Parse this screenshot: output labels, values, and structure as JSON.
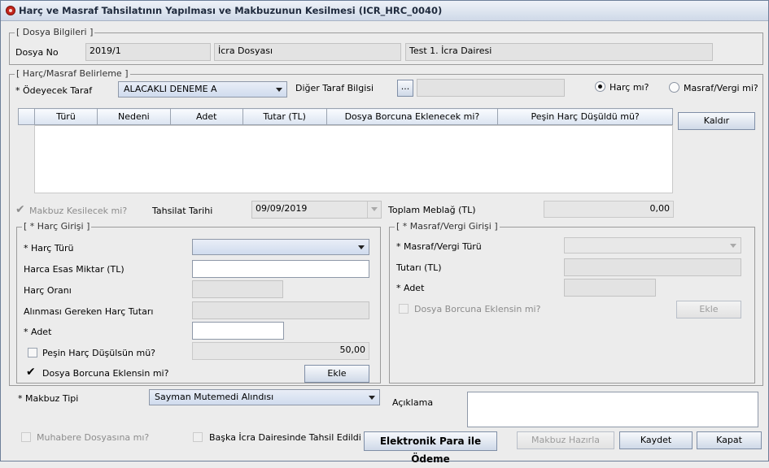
{
  "window": {
    "title": "Harç ve Masraf Tahsilatının Yapılması ve Makbuzunun Kesilmesi (ICR_HRC_0040)"
  },
  "dosya": {
    "group_title": "Dosya Bilgileri",
    "label": "Dosya No",
    "no": "2019/1",
    "type": "İcra Dosyası",
    "office": "Test 1. İcra Dairesi"
  },
  "harc_masraf": {
    "group_title": "Harç/Masraf Belirleme",
    "odeyecek_label": "* Ödeyecek Taraf",
    "odeyecek_value": "ALACAKLI DENEME A",
    "diger_label": "Diğer Taraf Bilgisi",
    "diger_button": "...",
    "diger_value": "",
    "radio_harc": "Harç mı?",
    "radio_masraf": "Masraf/Vergi mi?",
    "selected": "harc",
    "remove_button": "Kaldır",
    "table_columns": [
      "Türü",
      "Nedeni",
      "Adet",
      "Tutar (TL)",
      "Dosya Borcuna Eklenecek mi?",
      "Peşin Harç Düşüldü mü?"
    ],
    "table_rows": []
  },
  "tahsilat": {
    "makbuz_label": "Makbuz Kesilecek mi?",
    "makbuz_checked": true,
    "tarih_label": "Tahsilat Tarihi",
    "tarih_value": "09/09/2019",
    "toplam_label": "Toplam Meblağ (TL)",
    "toplam_value": "0,00"
  },
  "harc_girisi": {
    "group_title": "* Harç Girişi",
    "turu_label": "* Harç Türü",
    "turu_value": "",
    "esas_label": "Harca Esas Miktar (TL)",
    "esas_value": "",
    "oran_label": "Harç Oranı",
    "oran_value": "",
    "gereken_label": "Alınması Gereken Harç Tutarı",
    "gereken_value": "",
    "adet_label": "* Adet",
    "adet_value": "",
    "pesin_label": "Peşin Harç Düşülsün mü?",
    "pesin_checked": false,
    "pesin_value": "50,00",
    "dosya_label": "Dosya Borcuna Eklensin mi?",
    "dosya_checked": true,
    "ekle_button": "Ekle"
  },
  "masraf_girisi": {
    "group_title": "* Masraf/Vergi Girişi",
    "turu_label": "* Masraf/Vergi Türü",
    "turu_value": "",
    "tutar_label": "Tutarı (TL)",
    "tutar_value": "",
    "adet_label": "* Adet",
    "adet_value": "",
    "dosya_label": "Dosya Borcuna Eklensin mi?",
    "dosya_checked": false,
    "ekle_button": "Ekle"
  },
  "makbuz": {
    "tipi_label": "* Makbuz Tipi",
    "tipi_value": "Sayman Mutemedi Alındısı",
    "aciklama_label": "Açıklama",
    "aciklama_value": ""
  },
  "footer": {
    "muhabere_label": "Muhabere Dosyasına mı?",
    "baska_label": "Başka İcra Dairesinde Tahsil Edildi",
    "elektronik_button": "Elektronik Para ile Ödeme",
    "hazirla_button": "Makbuz Hazırla",
    "kaydet_button": "Kaydet",
    "kapat_button": "Kapat"
  }
}
